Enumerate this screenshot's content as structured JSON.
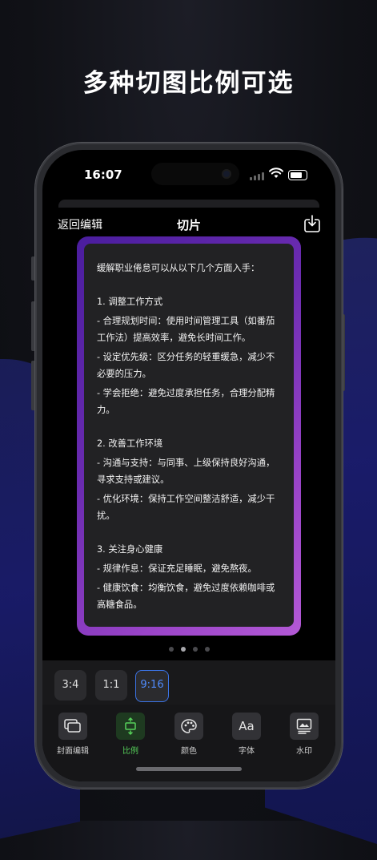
{
  "headline": "多种切图比例可选",
  "status_bar": {
    "time": "16:07"
  },
  "nav": {
    "back_label": "返回编辑",
    "title": "切片",
    "share_icon": "share-download-icon"
  },
  "card": {
    "intro": "缓解职业倦怠可以从以下几个方面入手：",
    "sections": [
      {
        "heading": "1. 调整工作方式",
        "items": [
          "- 合理规划时间：使用时间管理工具（如番茄工作法）提高效率，避免长时间工作。",
          "- 设定优先级：区分任务的轻重缓急，减少不必要的压力。",
          "- 学会拒绝：避免过度承担任务，合理分配精力。"
        ]
      },
      {
        "heading": "2. 改善工作环境",
        "items": [
          "- 沟通与支持：与同事、上级保持良好沟通，寻求支持或建议。",
          "- 优化环境：保持工作空间整洁舒适，减少干扰。"
        ]
      },
      {
        "heading": "3. 关注身心健康",
        "items": [
          "- 规律作息：保证充足睡眠，避免熬夜。",
          "- 健康饮食：均衡饮食，避免过度依赖咖啡或高糖食品。"
        ]
      }
    ]
  },
  "pager": {
    "count": 4,
    "active_index": 1
  },
  "ratios": {
    "options": [
      "3:4",
      "1:1",
      "9:16"
    ],
    "selected": "9:16"
  },
  "tabs": [
    {
      "label": "封面编辑",
      "icon": "cover-edit-icon"
    },
    {
      "label": "比例",
      "icon": "ratio-icon",
      "active": true
    },
    {
      "label": "颜色",
      "icon": "palette-icon"
    },
    {
      "label": "字体",
      "icon": "font-icon"
    },
    {
      "label": "水印",
      "icon": "watermark-icon"
    }
  ],
  "colors": {
    "accent_blue": "#3b74e6",
    "accent_green": "#56d15a",
    "frame_start": "#4a1d9e",
    "frame_end": "#b359d6"
  }
}
